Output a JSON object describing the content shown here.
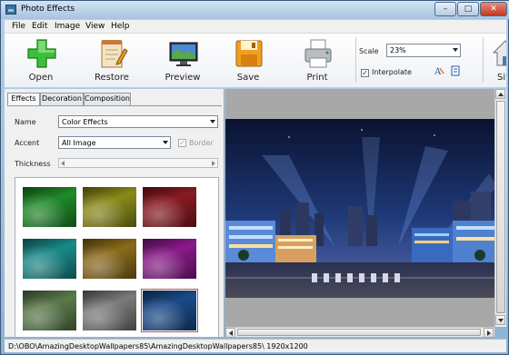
{
  "window": {
    "title": "Photo Effects",
    "controls": [
      "–",
      "□",
      "✕"
    ]
  },
  "menu": [
    "File",
    "Edit",
    "Image",
    "View",
    "Help"
  ],
  "toolbar": {
    "buttons": [
      {
        "label": "Open",
        "icon": "plus-icon"
      },
      {
        "label": "Restore",
        "icon": "notepad-icon"
      },
      {
        "label": "Preview",
        "icon": "monitor-icon"
      },
      {
        "label": "Save",
        "icon": "floppy-icon"
      },
      {
        "label": "Print",
        "icon": "printer-icon"
      }
    ],
    "scale_label": "Scale",
    "scale_value": "23%",
    "interpolate_label": "Interpolate",
    "interpolate_checked": true,
    "extra_label": "Sit"
  },
  "tabs": [
    {
      "label": "Effects",
      "active": true
    },
    {
      "label": "Decoration",
      "active": false
    },
    {
      "label": "Composition",
      "active": false
    }
  ],
  "effects": {
    "name_label": "Name",
    "name_value": "Color Effects",
    "accent_label": "Accent",
    "accent_value": "All Image",
    "border_label": "Border",
    "border_checked": true,
    "thickness_label": "Thickness"
  },
  "thumbnails": [
    {
      "tint": "#1f8a2a"
    },
    {
      "tint": "#8a8a1a"
    },
    {
      "tint": "#8a1a22"
    },
    {
      "tint": "#1a8a8a"
    },
    {
      "tint": "#8a6a1a"
    },
    {
      "tint": "#8a1a8a"
    },
    {
      "tint": "#5a7a4a"
    },
    {
      "tint": "#7a7a7a"
    },
    {
      "tint": "#1a4a8a",
      "selected": true
    }
  ],
  "status": {
    "text": "D:\\OBO\\AmazingDesktopWallpapers85\\AmazingDesktopWallpapers85\\ 1920x1200"
  }
}
